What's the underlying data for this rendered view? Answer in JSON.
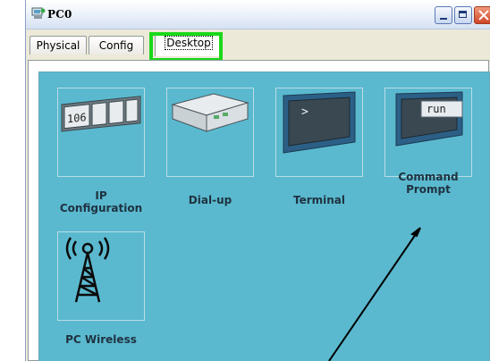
{
  "window": {
    "title": "PC0",
    "app_icon": "pc-icon",
    "controls": [
      "minimize-icon",
      "maximize-icon",
      "close-icon"
    ]
  },
  "tabs": [
    {
      "label": "Physical",
      "selected": false
    },
    {
      "label": "Config",
      "selected": false
    },
    {
      "label": "Desktop",
      "selected": true
    }
  ],
  "highlight_color": "#19d81a",
  "desktop_color": "#5ab9cf",
  "apps": [
    {
      "label": "IP Configuration",
      "icon": "ip-config-icon",
      "icon_text": "106"
    },
    {
      "label": "Dial-up",
      "icon": "modem-icon"
    },
    {
      "label": "Terminal",
      "icon": "terminal-icon",
      "icon_text": ">"
    },
    {
      "label": "Command Prompt",
      "icon": "command-prompt-icon",
      "icon_text": "run"
    },
    {
      "label": "PC Wireless",
      "icon": "wireless-antenna-icon"
    }
  ]
}
